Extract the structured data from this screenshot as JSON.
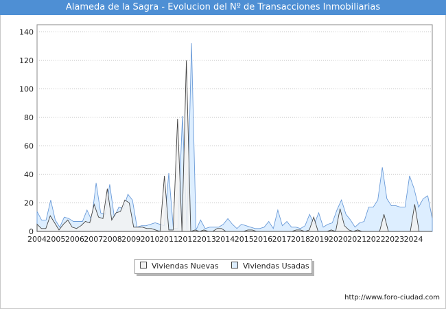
{
  "chart_data": {
    "type": "area",
    "title": "Alameda de la Sagra - Evolucion del Nº de Transacciones Inmobiliarias",
    "xlabel": "",
    "ylabel": "",
    "ylim": [
      0,
      145
    ],
    "yticks": [
      "0",
      "20",
      "40",
      "60",
      "80",
      "100",
      "120",
      "140"
    ],
    "x_tick_labels": [
      "2004",
      "2005",
      "2006",
      "2007",
      "2008",
      "2009",
      "2010",
      "2011",
      "2012",
      "2013",
      "2014",
      "2015",
      "2016",
      "2017",
      "2018",
      "2019",
      "2020",
      "2021",
      "2022",
      "2023",
      "2024"
    ],
    "grid": true,
    "legend_position": "bottom",
    "series": [
      {
        "name": "Viviendas Nuevas",
        "color": "#f2f2f2",
        "line_color": "#444444",
        "values": [
          5,
          2,
          2,
          11,
          6,
          1,
          5,
          8,
          3,
          2,
          4,
          7,
          6,
          19,
          10,
          9,
          30,
          8,
          13,
          14,
          22,
          20,
          3,
          3,
          3,
          2,
          2,
          1,
          0,
          39,
          1,
          1,
          79,
          0,
          120,
          0,
          1,
          0,
          1,
          0,
          0,
          2,
          2,
          0,
          0,
          0,
          0,
          0,
          1,
          1,
          0,
          0,
          0,
          0,
          0,
          0,
          0,
          0,
          0,
          1,
          1,
          0,
          1,
          10,
          0,
          0,
          0,
          1,
          0,
          16,
          4,
          1,
          0,
          1,
          0,
          0,
          0,
          0,
          0,
          12,
          0,
          0,
          0,
          0,
          0,
          0,
          19,
          0,
          0,
          0,
          0
        ]
      },
      {
        "name": "Viviendas Usadas",
        "color": "#ddeeff",
        "line_color": "#6b9bd8",
        "values": [
          14,
          8,
          8,
          22,
          8,
          3,
          10,
          9,
          7,
          7,
          7,
          15,
          8,
          34,
          13,
          12,
          33,
          10,
          17,
          16,
          26,
          22,
          3,
          4,
          4,
          5,
          6,
          5,
          4,
          41,
          2,
          2,
          81,
          1,
          132,
          1,
          8,
          2,
          3,
          3,
          3,
          5,
          9,
          5,
          2,
          5,
          4,
          3,
          2,
          2,
          3,
          7,
          2,
          15,
          4,
          7,
          3,
          3,
          2,
          4,
          12,
          5,
          13,
          3,
          5,
          6,
          15,
          22,
          12,
          8,
          3,
          6,
          7,
          17,
          17,
          22,
          45,
          23,
          18,
          18,
          17,
          17,
          39,
          30,
          17,
          23,
          25,
          9
        ]
      }
    ]
  },
  "legend": {
    "item1_label": "Viviendas Nuevas",
    "item2_label": "Viviendas Usadas"
  },
  "footer": {
    "url": "http://www.foro-ciudad.com"
  }
}
